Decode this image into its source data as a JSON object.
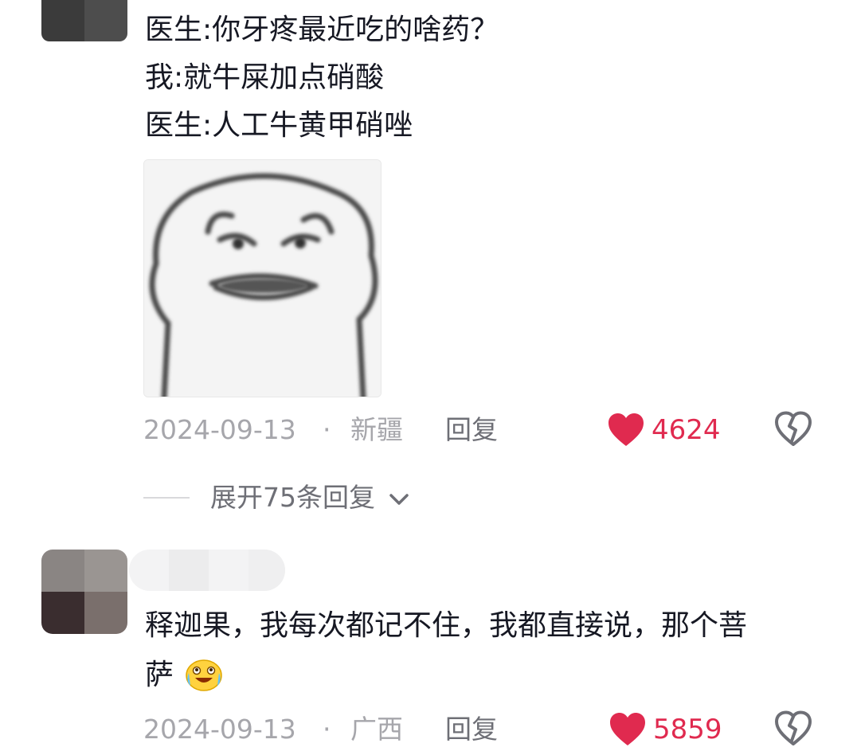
{
  "comment1": {
    "lines": [
      "医生:你牙疼最近吃的啥药？",
      "我:就牛屎加点硝酸",
      "医生:人工牛黄甲硝唑"
    ],
    "sticker_icon": "grimacing-frog-sticker",
    "date": "2024-09-13",
    "separator": "·",
    "location": "新疆",
    "reply_label": "回复",
    "likes": "4624",
    "expand_label": "展开75条回复"
  },
  "comment2": {
    "lines": [
      "释迦果，我每次都记不住，我都直接说，那个菩",
      "萨"
    ],
    "emoji_icon": "crying-laughing-emoji",
    "date": "2024-09-13",
    "separator": "·",
    "location": "广西",
    "reply_label": "回复",
    "likes": "5859"
  },
  "colors": {
    "like_red": "#e02a4f",
    "meta_gray": "#a6a6ab",
    "text": "#161823"
  }
}
